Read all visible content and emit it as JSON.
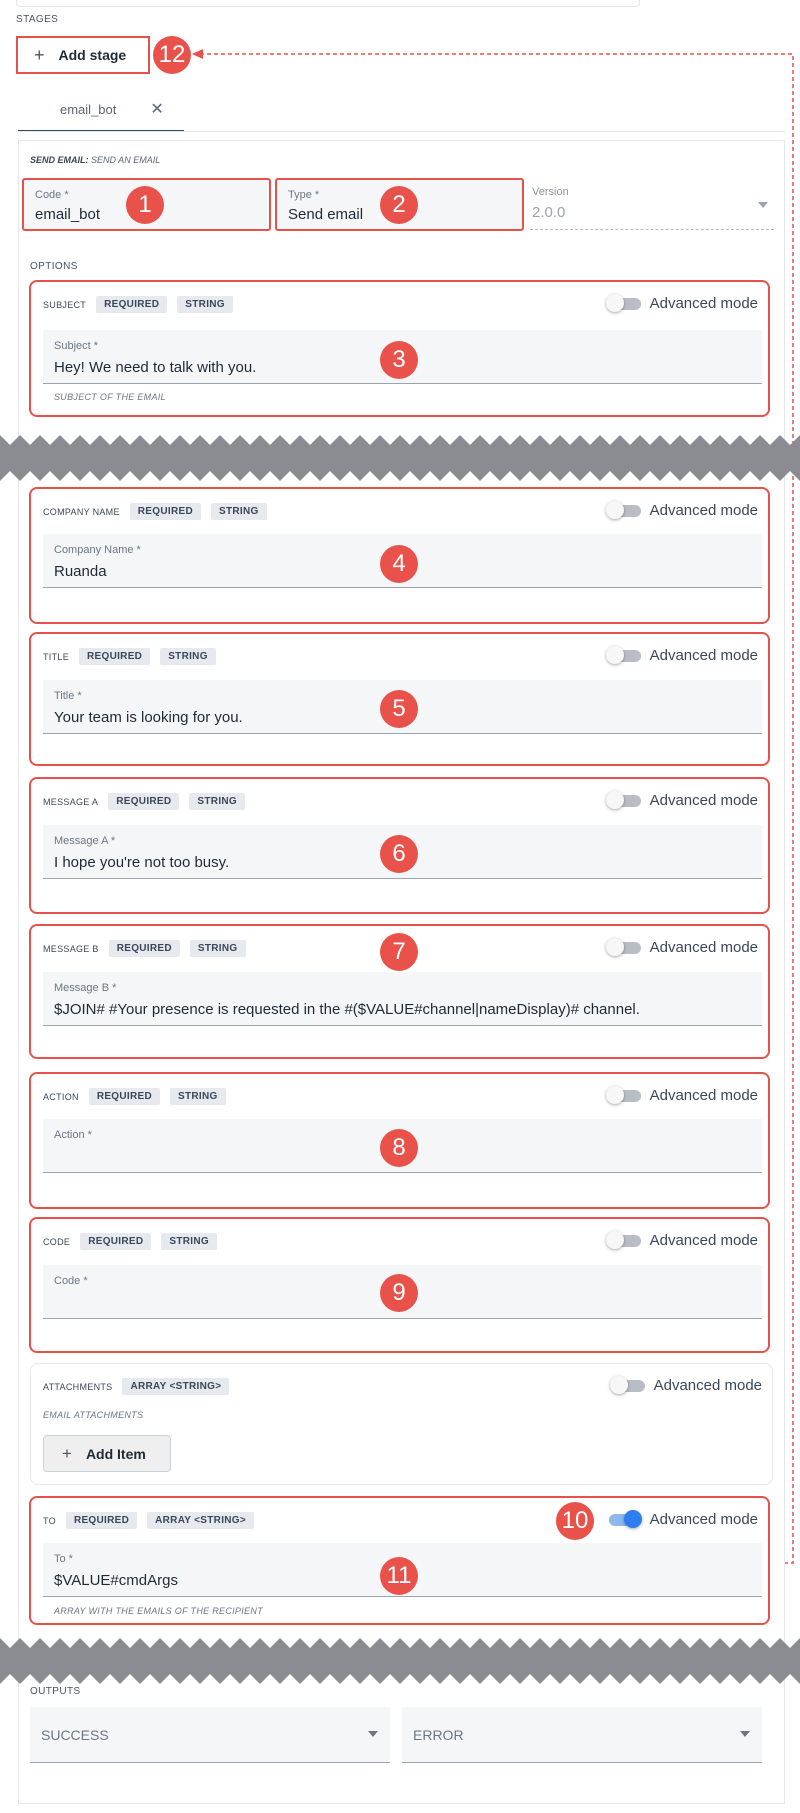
{
  "stages": {
    "section_label": "STAGES",
    "add_stage_label": "Add stage"
  },
  "tab": {
    "label": "email_bot"
  },
  "stage": {
    "title_bold": "SEND EMAIL:",
    "title_rest": "SEND AN EMAIL",
    "code": {
      "label": "Code *",
      "value": "email_bot"
    },
    "type": {
      "label": "Type *",
      "value": "Send email"
    },
    "version": {
      "label": "Version",
      "value": "2.0.0"
    }
  },
  "options": {
    "section_label": "OPTIONS",
    "advanced_mode_label": "Advanced mode",
    "badge_required": "REQUIRED",
    "badge_string": "STRING",
    "badge_array_string": "ARRAY <STRING>",
    "subject": {
      "name": "SUBJECT",
      "label": "Subject *",
      "value": "Hey! We need to talk with you.",
      "hint": "SUBJECT OF THE EMAIL",
      "advanced": false
    },
    "company_name": {
      "name": "COMPANY NAME",
      "label": "Company Name *",
      "value": "Ruanda",
      "advanced": false
    },
    "title": {
      "name": "TITLE",
      "label": "Title *",
      "value": "Your team is looking for you.",
      "advanced": false
    },
    "message_a": {
      "name": "MESSAGE A",
      "label": "Message A *",
      "value": "I hope you're not too busy.",
      "advanced": false
    },
    "message_b": {
      "name": "MESSAGE B",
      "label": "Message B *",
      "value": "$JOIN# #Your presence is requested in the #($VALUE#channel|nameDisplay)# channel.",
      "advanced": false
    },
    "action": {
      "name": "ACTION",
      "label": "Action *",
      "value": "",
      "advanced": false
    },
    "code": {
      "name": "CODE",
      "label": "Code *",
      "value": "",
      "advanced": false
    },
    "attachments": {
      "name": "ATTACHMENTS",
      "hint": "EMAIL ATTACHMENTS",
      "add_item_label": "Add Item",
      "advanced": false
    },
    "to": {
      "name": "TO",
      "label": "To *",
      "value": "$VALUE#cmdArgs",
      "hint": "ARRAY WITH THE EMAILS OF THE RECIPIENT",
      "advanced": true
    }
  },
  "outputs": {
    "section_label": "OUTPUTS",
    "success_value": "SUCCESS",
    "error_value": "ERROR"
  },
  "markers": [
    "1",
    "2",
    "3",
    "4",
    "5",
    "6",
    "7",
    "8",
    "9",
    "10",
    "11",
    "12"
  ],
  "colors": {
    "annotation_red": "#e7514b",
    "toggle_on": "#2d7ff0",
    "tab_underline": "#2c4d78",
    "break_band": "#8a8c91"
  }
}
